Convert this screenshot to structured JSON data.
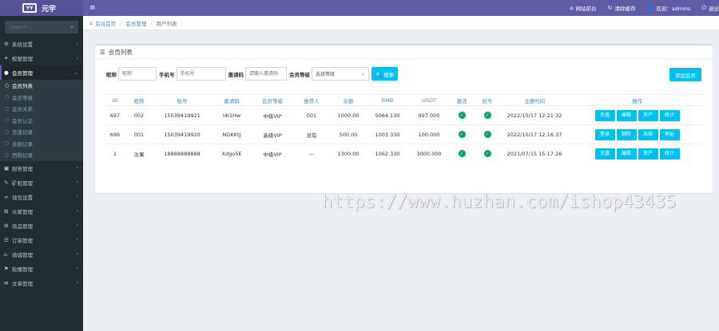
{
  "topbar": {
    "logo_mark": "YY",
    "logo_text": "元宇",
    "menu_icon": "≡",
    "links": [
      {
        "icon": "home-icon",
        "glyph": "⌂",
        "label": "网站前台"
      },
      {
        "icon": "refresh-icon",
        "glyph": "↻",
        "label": "清除缓存"
      },
      {
        "icon": "user-icon",
        "glyph": "👤",
        "label": "欢迎：admins"
      },
      {
        "icon": "logout-icon",
        "glyph": "⏻",
        "label": "退出"
      }
    ]
  },
  "sidebar": {
    "search_placeholder": "Search...",
    "items": [
      {
        "icon": "gear-icon",
        "glyph": "⚙",
        "label": "系统设置",
        "chev": "‹"
      },
      {
        "icon": "users-icon",
        "glyph": "⚭",
        "label": "权限管理",
        "chev": "‹"
      },
      {
        "icon": "user-group-icon",
        "glyph": "●",
        "label": "会员管理",
        "chev": "⌄"
      }
    ],
    "sub_items": [
      "会员列表",
      "会员等级",
      "会员关系",
      "会员认证",
      "充值记录",
      "余额记录",
      "团购记录"
    ],
    "items_after": [
      {
        "icon": "wallet-icon",
        "glyph": "▣",
        "label": "财务管理",
        "chev": "‹"
      },
      {
        "icon": "hammer-icon",
        "glyph": "✎",
        "label": "矿机管理",
        "chev": "‹"
      },
      {
        "icon": "link-icon",
        "glyph": "∞",
        "label": "钱包设置",
        "chev": "‹"
      },
      {
        "icon": "cart-icon",
        "glyph": "⊞",
        "label": "众筹管理",
        "chev": "‹"
      },
      {
        "icon": "box-icon",
        "glyph": "⊞",
        "label": "商品管理",
        "chev": "‹"
      },
      {
        "icon": "list-icon",
        "glyph": "☰",
        "label": "订单管理",
        "chev": "‹"
      },
      {
        "icon": "shop-icon",
        "glyph": "⌂",
        "label": "商城管理",
        "chev": "‹"
      },
      {
        "icon": "flag-icon",
        "glyph": "⚑",
        "label": "轮播管理",
        "chev": "‹"
      },
      {
        "icon": "chat-icon",
        "glyph": "✉",
        "label": "文章管理",
        "chev": "‹"
      }
    ]
  },
  "breadcrumb": {
    "icon": "⌂",
    "items": [
      "后台首页",
      "会员管理",
      "用户列表"
    ]
  },
  "panel": {
    "title_icon": "☰",
    "title": "会员列表",
    "filters": {
      "nickname_label": "昵称",
      "nickname_placeholder": "昵称",
      "phone_label": "手机号",
      "phone_placeholder": "手机号",
      "invite_label": "邀请码",
      "invite_placeholder": "请输入邀请码",
      "level_label": "会员等级",
      "level_value": "选择等级",
      "search_button": "🔍 搜索"
    },
    "add_button": "添加会员",
    "columns": [
      "ID",
      "昵称",
      "账号",
      "邀请码",
      "会员等级",
      "推荐人",
      "余额",
      "RMB",
      "USDT",
      "激活",
      "封号",
      "注册时间",
      "操作"
    ],
    "rows": [
      {
        "id": "697",
        "nickname": "002",
        "account": "15039419921",
        "invite": "I4I1Hw",
        "level": "中级VIP",
        "referrer": "001",
        "balance": "1000.00",
        "rmb": "5064.130",
        "usdt": "997.000",
        "active": true,
        "banned": true,
        "time": "2022/10/17 12:21:32",
        "actions": [
          "充值",
          "编辑",
          "资产",
          "统计"
        ]
      },
      {
        "id": "696",
        "nickname": "001",
        "account": "15039419920",
        "invite": "NGKKtJ",
        "level": "高级VIP",
        "referrer": "没有",
        "balance": "500.00",
        "rmb": "1003.330",
        "usdt": "100.000",
        "active": true,
        "banned": true,
        "time": "2022/10/17 12:16:37",
        "actions": [
          "登录",
          "删除",
          "冻结",
          "地址"
        ]
      },
      {
        "id": "1",
        "nickname": "汝果",
        "account": "18888888888",
        "invite": "Xdgo5E",
        "level": "中级VIP",
        "referrer": "---",
        "balance": "1300.00",
        "rmb": "1062.330",
        "usdt": "3000.000",
        "active": true,
        "banned": true,
        "time": "2021/07/15 15:17:26",
        "actions": [
          "充值",
          "编辑",
          "资产",
          "统计"
        ]
      }
    ]
  },
  "watermark": "https://www.huzhan.com/ishop43435",
  "colors": {
    "header": "#605ca8",
    "sidebar": "#222d32",
    "accent": "#00c0ef",
    "ok": "#00a65a"
  }
}
